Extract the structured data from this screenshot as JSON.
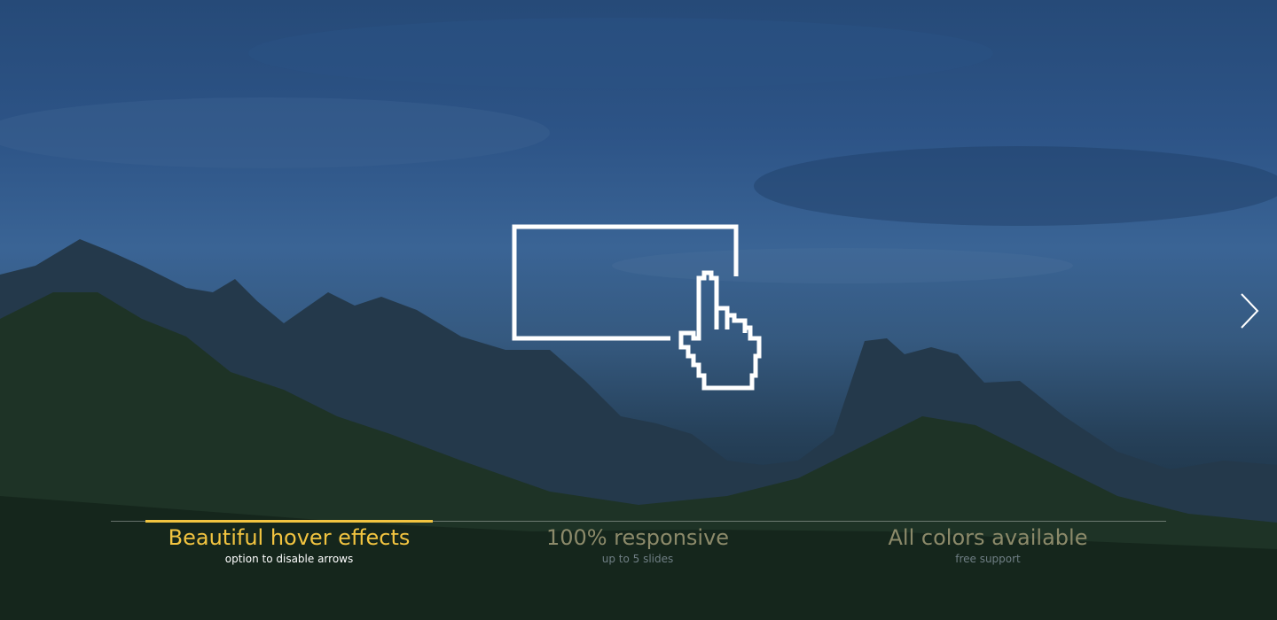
{
  "slider": {
    "background": "mountain-landscape-overlay",
    "accent_color": "#f2c440",
    "next_icon": "chevron-right-icon",
    "hero_icon": "pixel-hand-cursor-icon",
    "tabs": [
      {
        "title": "Beautiful hover effects",
        "subtitle": "option to disable arrows",
        "active": true
      },
      {
        "title": "100% responsive",
        "subtitle": "up to 5 slides",
        "active": false
      },
      {
        "title": "All colors available",
        "subtitle": "free support",
        "active": false
      }
    ]
  }
}
